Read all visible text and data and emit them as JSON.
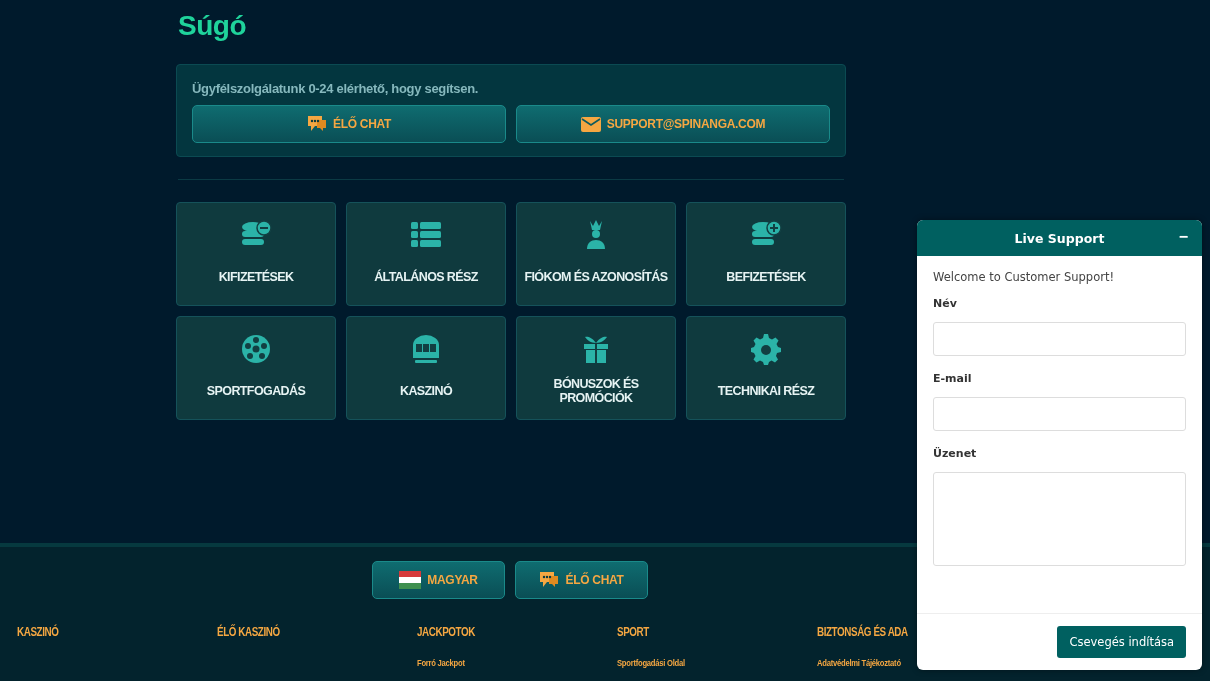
{
  "page": {
    "title": "Súgó"
  },
  "support": {
    "text": "Ügyfélszolgálatunk 0-24 elérhető, hogy segítsen.",
    "buttons": [
      {
        "kind": "chat",
        "label": "ÉLŐ CHAT"
      },
      {
        "kind": "mail",
        "label": "SUPPORT@SPINANGA.COM"
      }
    ]
  },
  "categories": [
    {
      "label": "KIFIZETÉSEK"
    },
    {
      "label": "ÁLTALÁNOS RÉSZ"
    },
    {
      "label": "FIÓKOM ÉS AZONOSÍTÁS"
    },
    {
      "label": "BEFIZETÉSEK"
    },
    {
      "label": "SPORTFOGADÁS"
    },
    {
      "label": "KASZINÓ"
    },
    {
      "label": "BÓNUSZOK ÉS PROMÓCIÓK"
    },
    {
      "label": "TECHNIKAI RÉSZ"
    }
  ],
  "footer": {
    "buttons": [
      {
        "kind": "language",
        "label": "MAGYAR"
      },
      {
        "kind": "chat",
        "label": "ÉLŐ CHAT"
      }
    ],
    "columns": [
      {
        "heading": "KASZINÓ"
      },
      {
        "heading": "ÉLŐ KASZINÓ"
      },
      {
        "heading": "JACKPOTOK",
        "links": [
          "Forró Jackpot"
        ]
      },
      {
        "heading": "SPORT",
        "links": [
          "Sportfogadási Oldal"
        ]
      },
      {
        "heading": "BIZTONSÁG ÉS ADA",
        "links": [
          "Adatvédelmi Tájékoztató"
        ]
      }
    ]
  },
  "chat_widget": {
    "title": "Live Support",
    "minimize": "−",
    "welcome": "Welcome to Customer Support!",
    "fields": [
      {
        "kind": "input",
        "label": "Név"
      },
      {
        "kind": "input",
        "label": "E-mail"
      },
      {
        "kind": "textarea",
        "label": "Üzenet"
      }
    ],
    "submit": "Csevegés indítása"
  }
}
